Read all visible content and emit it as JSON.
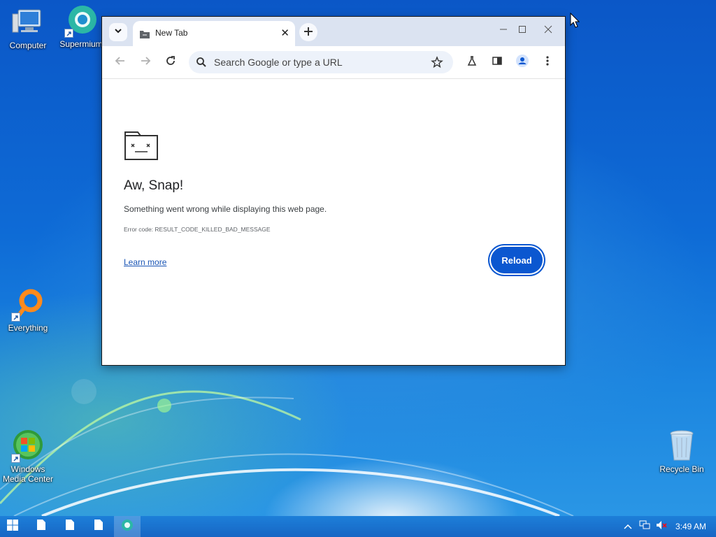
{
  "desktop": {
    "icons": [
      {
        "label": "Computer"
      },
      {
        "label": "Supermium"
      },
      {
        "label": "Everything"
      },
      {
        "label": "Windows Media Center"
      },
      {
        "label": "Recycle Bin"
      }
    ]
  },
  "browser": {
    "tab": {
      "title": "New Tab"
    },
    "omnibox": {
      "placeholder": "Search Google or type a URL"
    },
    "error": {
      "heading": "Aw, Snap!",
      "message": "Something went wrong while displaying this web page.",
      "code": "Error code: RESULT_CODE_KILLED_BAD_MESSAGE",
      "learn_more": "Learn more",
      "reload": "Reload"
    }
  },
  "taskbar": {
    "clock": "3:49 AM"
  },
  "colors": {
    "accent": "#0b57d0",
    "tabstrip": "#dbe3f1",
    "omnibox": "#edf2fa",
    "taskbar": "#1766c4"
  },
  "icons": [
    "computer-icon",
    "supermium-icon",
    "everything-icon",
    "media-center-icon",
    "recycle-bin-icon",
    "tab-search-icon",
    "sad-folder-icon",
    "close-icon",
    "plus-icon",
    "minimize-icon",
    "maximize-icon",
    "back-arrow-icon",
    "forward-arrow-icon",
    "reload-icon",
    "search-icon",
    "star-icon",
    "flask-icon",
    "side-panel-icon",
    "profile-icon",
    "more-icon",
    "start-icon",
    "file-icon",
    "chevron-up-icon",
    "network-icon",
    "volume-muted-icon",
    "mouse-cursor-icon"
  ]
}
